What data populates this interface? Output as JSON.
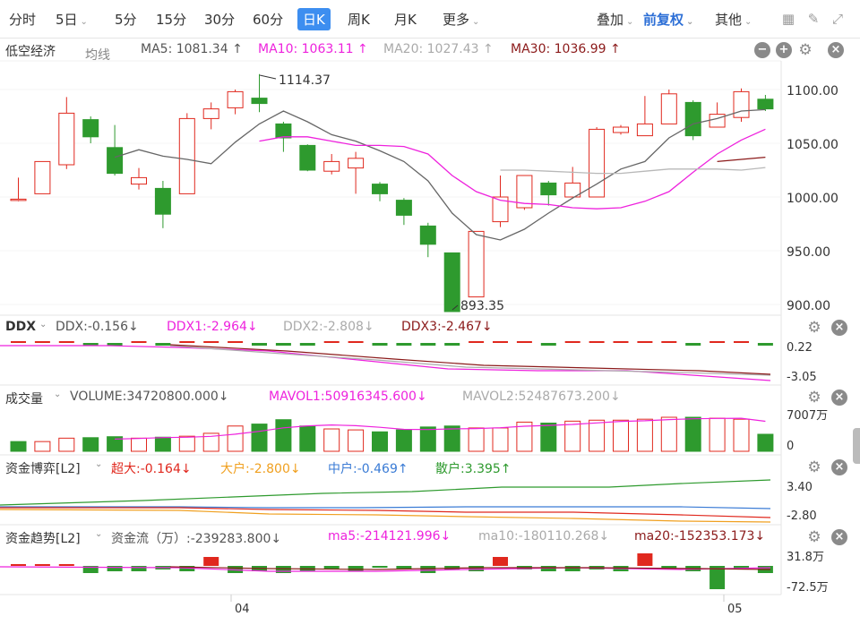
{
  "toolbar": {
    "periods": [
      "分时",
      "5日",
      "5分",
      "15分",
      "30分",
      "60分",
      "日K",
      "周K",
      "月K",
      "更多"
    ],
    "active_period": "日K",
    "overlay": "叠加",
    "adjust": "前复权",
    "other": "其他"
  },
  "main_panel": {
    "title": "低空经济",
    "indicator": "均线",
    "ma5": "MA5: 1081.34 ↑",
    "ma10": "MA10: 1063.11 ↑",
    "ma20": "MA20: 1027.43 ↑",
    "ma30": "MA30: 1036.99 ↑",
    "high_label": "1114.37",
    "low_label": "893.35",
    "y_ticks": [
      "1100.00",
      "1050.00",
      "1000.00",
      "950.00",
      "900.00"
    ]
  },
  "ddx_panel": {
    "title": "DDX",
    "ddx": "DDX:-0.156↓",
    "ddx1": "DDX1:-2.964↓",
    "ddx2": "DDX2:-2.808↓",
    "ddx3": "DDX3:-2.467↓",
    "y_ticks": [
      "0.22",
      "-3.05"
    ]
  },
  "volume_panel": {
    "title": "成交量",
    "volume": "VOLUME:34720800.000↓",
    "mavol1": "MAVOL1:50916345.600↓",
    "mavol2": "MAVOL2:52487673.200↓",
    "y_ticks": [
      "7007万",
      "0"
    ]
  },
  "game_panel": {
    "title": "资金博弈[L2]",
    "super": "超大:-0.164↓",
    "big": "大户:-2.800↓",
    "mid": "中户:-0.469↑",
    "retail": "散户:3.395↑",
    "y_ticks": [
      "3.40",
      "-2.80"
    ]
  },
  "trend_panel": {
    "title": "资金趋势[L2]",
    "flow": "资金流（万）:-239283.800↓",
    "ma5": "ma5:-214121.996↓",
    "ma10": "ma10:-180110.268↓",
    "ma20": "ma20:-152353.173↓",
    "y_ticks": [
      "31.8万",
      "-72.5万"
    ]
  },
  "x_axis": [
    "04",
    "05"
  ],
  "colors": {
    "up": "#e0281e",
    "down": "#2e9a2e",
    "ma5": "#666666",
    "ma10": "#ee22dd",
    "ma20": "#b8b8b8",
    "ma30": "#8b1a1a",
    "active": "#3d8ef0"
  },
  "chart_data": {
    "type": "candlestick",
    "candles": [
      {
        "o": 998,
        "c": 998,
        "h": 1018,
        "l": 996
      },
      {
        "o": 1003,
        "c": 1033,
        "h": 1033,
        "l": 1003
      },
      {
        "o": 1030,
        "c": 1078,
        "h": 1093,
        "l": 1026
      },
      {
        "o": 1072,
        "c": 1056,
        "h": 1075,
        "l": 1050
      },
      {
        "o": 1046,
        "c": 1022,
        "h": 1067,
        "l": 1020
      },
      {
        "o": 1012,
        "c": 1018,
        "h": 1027,
        "l": 1007
      },
      {
        "o": 1008,
        "c": 984,
        "h": 1015,
        "l": 971
      },
      {
        "o": 1003,
        "c": 1073,
        "h": 1078,
        "l": 1003
      },
      {
        "o": 1073,
        "c": 1082,
        "h": 1088,
        "l": 1063
      },
      {
        "o": 1083,
        "c": 1098,
        "h": 1100,
        "l": 1077
      },
      {
        "o": 1092,
        "c": 1087,
        "h": 1114.37,
        "l": 1079
      },
      {
        "o": 1068,
        "c": 1055,
        "h": 1070,
        "l": 1042
      },
      {
        "o": 1048,
        "c": 1025,
        "h": 1049,
        "l": 1024
      },
      {
        "o": 1024,
        "c": 1033,
        "h": 1040,
        "l": 1021
      },
      {
        "o": 1027,
        "c": 1036,
        "h": 1042,
        "l": 1003
      },
      {
        "o": 1012,
        "c": 1003,
        "h": 1014,
        "l": 996
      },
      {
        "o": 997,
        "c": 983,
        "h": 999,
        "l": 974
      },
      {
        "o": 973,
        "c": 956,
        "h": 976,
        "l": 944
      },
      {
        "o": 948,
        "c": 893.35,
        "h": 948,
        "l": 893.35
      },
      {
        "o": 907,
        "c": 968,
        "h": 968,
        "l": 907
      },
      {
        "o": 977,
        "c": 1000,
        "h": 1020,
        "l": 972
      },
      {
        "o": 990,
        "c": 1020,
        "h": 1020,
        "l": 988
      },
      {
        "o": 1013,
        "c": 1002,
        "h": 1015,
        "l": 992
      },
      {
        "o": 1000,
        "c": 1013,
        "h": 1028,
        "l": 1000
      },
      {
        "o": 1000,
        "c": 1063,
        "h": 1065,
        "l": 1000
      },
      {
        "o": 1060,
        "c": 1065,
        "h": 1067,
        "l": 1058
      },
      {
        "o": 1057,
        "c": 1068,
        "h": 1094,
        "l": 1057
      },
      {
        "o": 1068,
        "c": 1096,
        "h": 1100,
        "l": 1068
      },
      {
        "o": 1088,
        "c": 1057,
        "h": 1090,
        "l": 1053
      },
      {
        "o": 1065,
        "c": 1077,
        "h": 1088,
        "l": 1065
      },
      {
        "o": 1074,
        "c": 1098,
        "h": 1101,
        "l": 1070
      },
      {
        "o": 1091,
        "c": 1082,
        "h": 1095,
        "l": 1080
      }
    ],
    "ma5": [
      null,
      null,
      null,
      null,
      1037,
      1044,
      1038,
      1035,
      1031,
      1051,
      1068,
      1080,
      1070,
      1058,
      1052,
      1043,
      1033,
      1015,
      985,
      965,
      960,
      970,
      985,
      999,
      1012,
      1026,
      1033,
      1055,
      1068,
      1073,
      1080,
      1081.34
    ],
    "ma10": [
      null,
      null,
      null,
      null,
      null,
      null,
      null,
      null,
      null,
      null,
      1052,
      1056,
      1056,
      1052,
      1048,
      1048,
      1047,
      1040,
      1020,
      1005,
      997,
      994,
      993,
      990,
      989,
      990,
      996,
      1005,
      1023,
      1040,
      1053,
      1063.11
    ],
    "ma20": [
      null,
      null,
      null,
      null,
      null,
      null,
      null,
      null,
      null,
      null,
      null,
      null,
      null,
      null,
      null,
      null,
      null,
      null,
      null,
      null,
      1025,
      1025,
      1024,
      1023,
      1022,
      1022,
      1024,
      1026,
      1026,
      1026,
      1025,
      1027.43
    ],
    "ma30": [
      null,
      null,
      null,
      null,
      null,
      null,
      null,
      null,
      null,
      null,
      null,
      null,
      null,
      null,
      null,
      null,
      null,
      null,
      null,
      null,
      null,
      null,
      null,
      null,
      null,
      null,
      null,
      null,
      null,
      1033,
      1035,
      1036.99
    ],
    "y_range": [
      893.35,
      1114.37
    ],
    "volume": [
      20,
      20,
      27,
      28,
      30,
      27,
      29,
      31,
      37,
      52,
      56,
      65,
      52,
      46,
      44,
      40,
      44,
      50,
      52,
      48,
      48,
      60,
      58,
      62,
      64,
      64,
      66,
      70,
      70,
      68,
      66,
      35
    ],
    "volume_up": [
      false,
      true,
      true,
      false,
      false,
      true,
      false,
      true,
      true,
      true,
      false,
      false,
      false,
      true,
      true,
      false,
      false,
      false,
      false,
      true,
      true,
      true,
      false,
      true,
      true,
      true,
      true,
      true,
      false,
      true,
      true,
      false
    ],
    "volume_unit": "万",
    "volume_max": 7007
  }
}
